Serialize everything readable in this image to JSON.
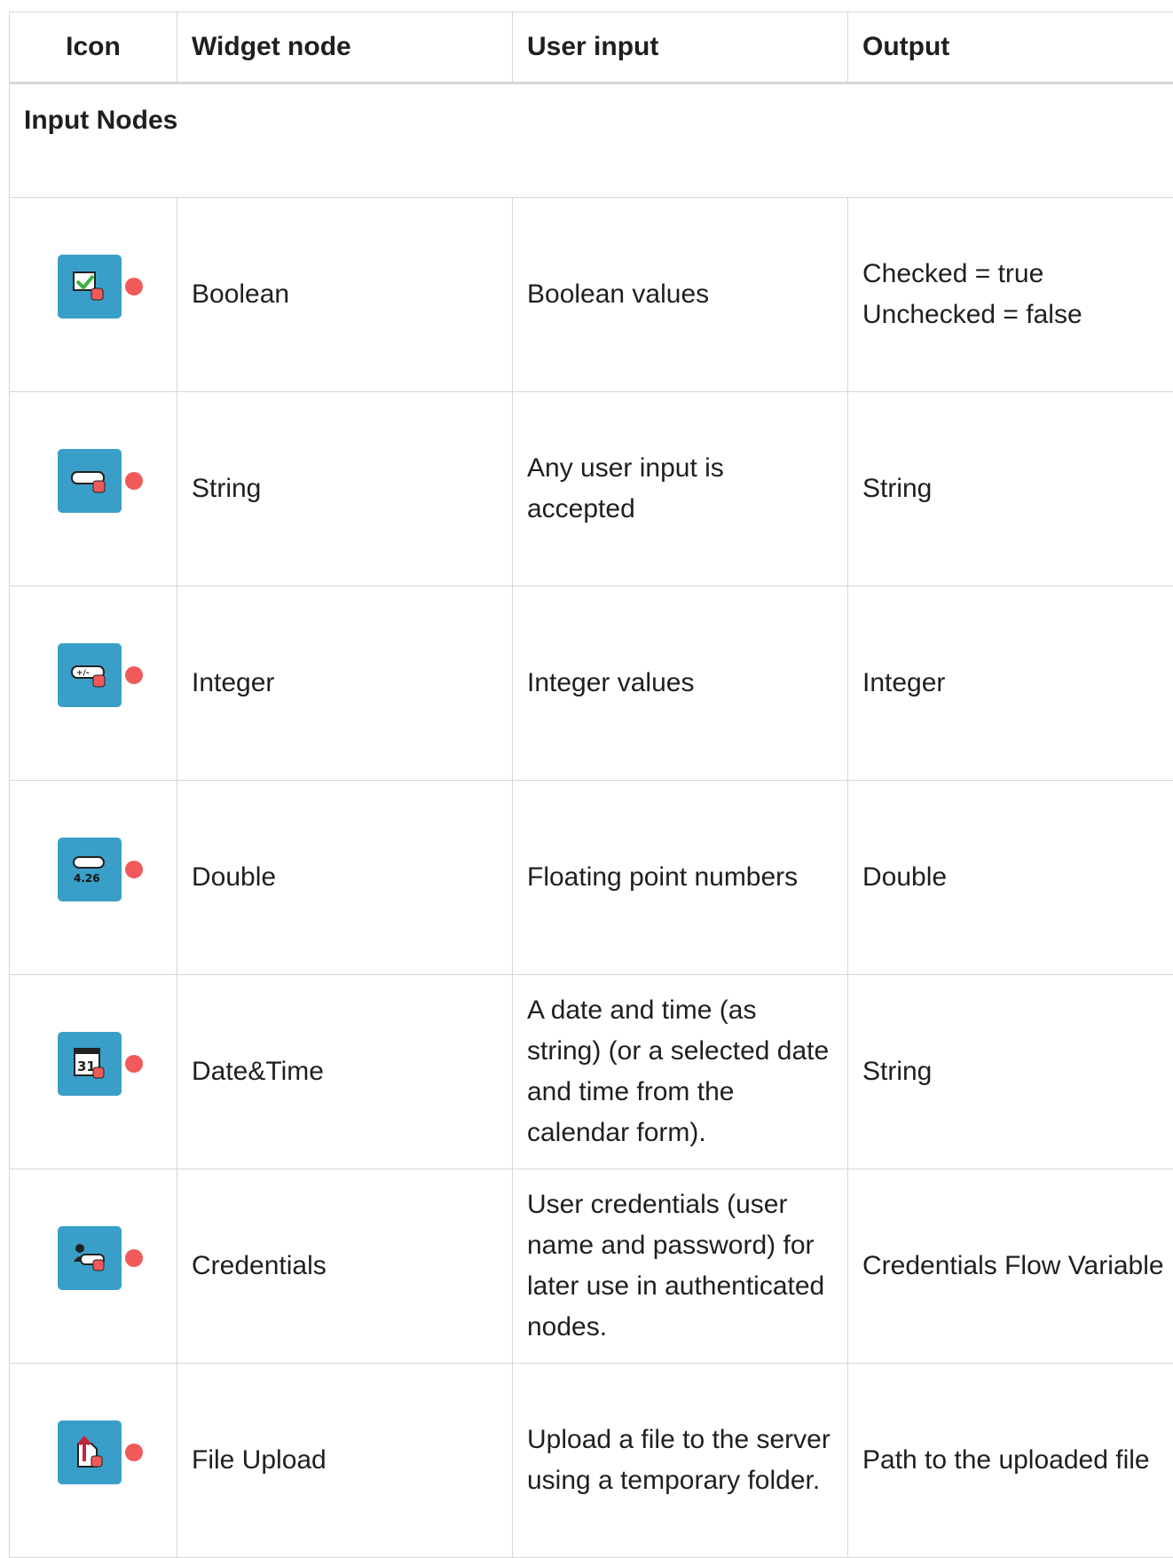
{
  "header": {
    "icon": "Icon",
    "widget_node": "Widget node",
    "user_input": "User input",
    "output": "Output"
  },
  "section_title": "Input Nodes",
  "rows": [
    {
      "icon": "boolean-widget-icon",
      "widget": "Boolean",
      "input": "Boolean values",
      "output_lines": [
        "Checked = true",
        "Unchecked = false"
      ]
    },
    {
      "icon": "string-widget-icon",
      "widget": "String",
      "input": "Any user input is accepted",
      "output_lines": [
        "String"
      ]
    },
    {
      "icon": "integer-widget-icon",
      "widget": "Integer",
      "input": "Integer values",
      "output_lines": [
        "Integer"
      ]
    },
    {
      "icon": "double-widget-icon",
      "widget": "Double",
      "input": "Floating point numbers",
      "output_lines": [
        "Double"
      ]
    },
    {
      "icon": "date-time-widget-icon",
      "widget": "Date&Time",
      "input": "A date and time (as string) (or a selected date and time from the calendar form).",
      "output_lines": [
        "String"
      ]
    },
    {
      "icon": "credentials-widget-icon",
      "widget": "Credentials",
      "input": "User credentials (user name and password) for later use in authenticated nodes.",
      "output_lines": [
        "Credentials Flow Variable"
      ]
    },
    {
      "icon": "file-upload-widget-icon",
      "widget": "File Upload",
      "input": "Upload a file to the server using a temporary folder.",
      "output_lines": [
        "Path to the uploaded file"
      ]
    }
  ],
  "icon_labels": {
    "double": "4.26",
    "date": "31",
    "integer": "+/-"
  },
  "colors": {
    "node_bg": "#3a9fc8",
    "port": "#f05a5a",
    "grid": "#d6d6d6",
    "check": "#3cb043"
  }
}
